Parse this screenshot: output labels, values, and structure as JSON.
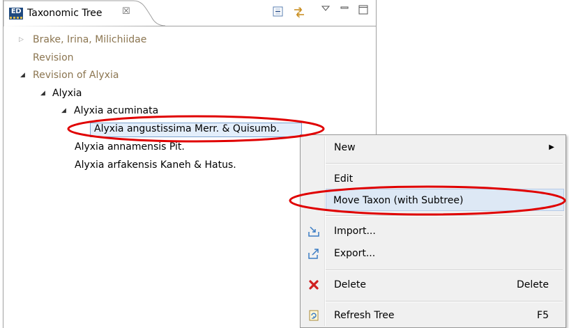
{
  "view": {
    "tab_title": "Taxonomic Tree",
    "close_glyph": "☒",
    "app_icon_text": "ED"
  },
  "tree": {
    "nodes": [
      {
        "label": "Brake, Irina, Milichiidae",
        "twisty": "▷"
      },
      {
        "label": "Revision"
      },
      {
        "label": "Revision of Alyxia",
        "twisty": "◢"
      },
      {
        "label": "Alyxia",
        "twisty": "◢"
      },
      {
        "label": "Alyxia acuminata",
        "twisty": "◢"
      },
      {
        "label": "Alyxia angustissima Merr. & Quisumb."
      },
      {
        "label": "Alyxia annamensis Pit."
      },
      {
        "label": "Alyxia arfakensis Kaneh & Hatus."
      }
    ]
  },
  "menu": {
    "new": {
      "label": "New",
      "arrow": "▶"
    },
    "edit": {
      "label": "Edit"
    },
    "move": {
      "label": "Move Taxon (with Subtree)"
    },
    "import": {
      "label": "Import..."
    },
    "export": {
      "label": "Export..."
    },
    "delete": {
      "label": "Delete",
      "shortcut": "Delete"
    },
    "refresh": {
      "label": "Refresh Tree",
      "shortcut": "F5"
    }
  },
  "colors": {
    "highlight_ellipse": "#e00000",
    "reference_text": "#8b7550"
  }
}
